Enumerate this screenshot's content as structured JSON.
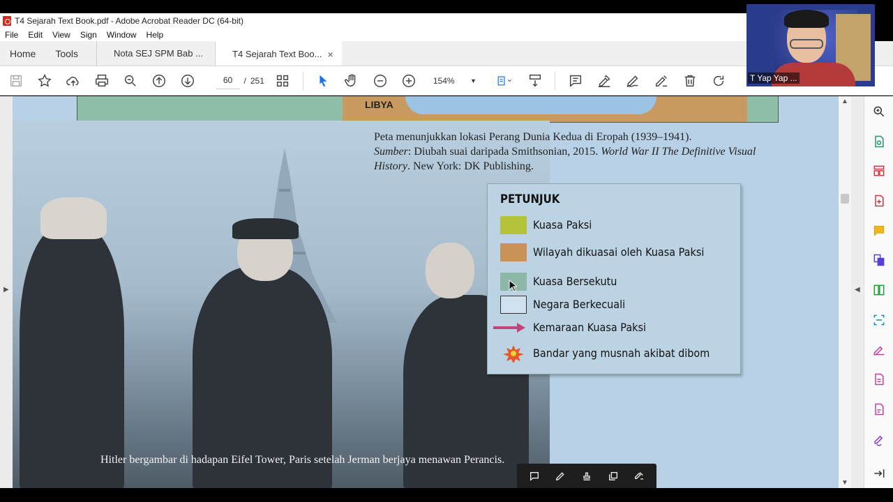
{
  "window": {
    "title": "T4 Sejarah Text Book.pdf - Adobe Acrobat Reader DC (64-bit)"
  },
  "menu": [
    "File",
    "Edit",
    "View",
    "Sign",
    "Window",
    "Help"
  ],
  "nav": {
    "home": "Home",
    "tools": "Tools"
  },
  "tabs": [
    {
      "label": "Nota SEJ SPM Bab ...",
      "active": false
    },
    {
      "label": "T4 Sejarah Text Boo...",
      "active": true,
      "close": "×"
    }
  ],
  "toolbar": {
    "page_current": "60",
    "page_separator": "/",
    "page_total": "251",
    "zoom": "154%"
  },
  "document": {
    "map_label": "LIBYA",
    "map_caption_line1": "Peta menunjukkan lokasi Perang Dunia Kedua di Eropah (1939–1941).",
    "map_source_label": "Sumber",
    "map_source_text": ": Diubah suai daripada Smithsonian, 2015.",
    "map_source_book": "World War II The Definitive Visual History",
    "map_source_publisher": ". New York: DK Publishing.",
    "legend": {
      "title": "PETUNJUK",
      "items": [
        {
          "label": "Kuasa Paksi",
          "color": "#b5c33a"
        },
        {
          "label": "Wilayah dikuasai oleh Kuasa Paksi",
          "color": "#c99357"
        },
        {
          "label": "Kuasa Bersekutu",
          "color": "#8db8a8"
        },
        {
          "label": "Negara Berkecuali",
          "color": "#cfe0ee"
        },
        {
          "label": "Kemaraan Kuasa Paksi",
          "color": "#c2457a"
        },
        {
          "label": "Bandar yang musnah akibat dibom",
          "color": "#e8562a"
        }
      ]
    },
    "photo_caption": "Hitler bergambar di hadapan Eifel Tower, Paris setelah Jerman berjaya menawan Perancis."
  },
  "webcam": {
    "name": "T Yap Yap ..."
  },
  "colors": {
    "accent": "#1473e6",
    "page_bg": "#b8d1e6"
  }
}
